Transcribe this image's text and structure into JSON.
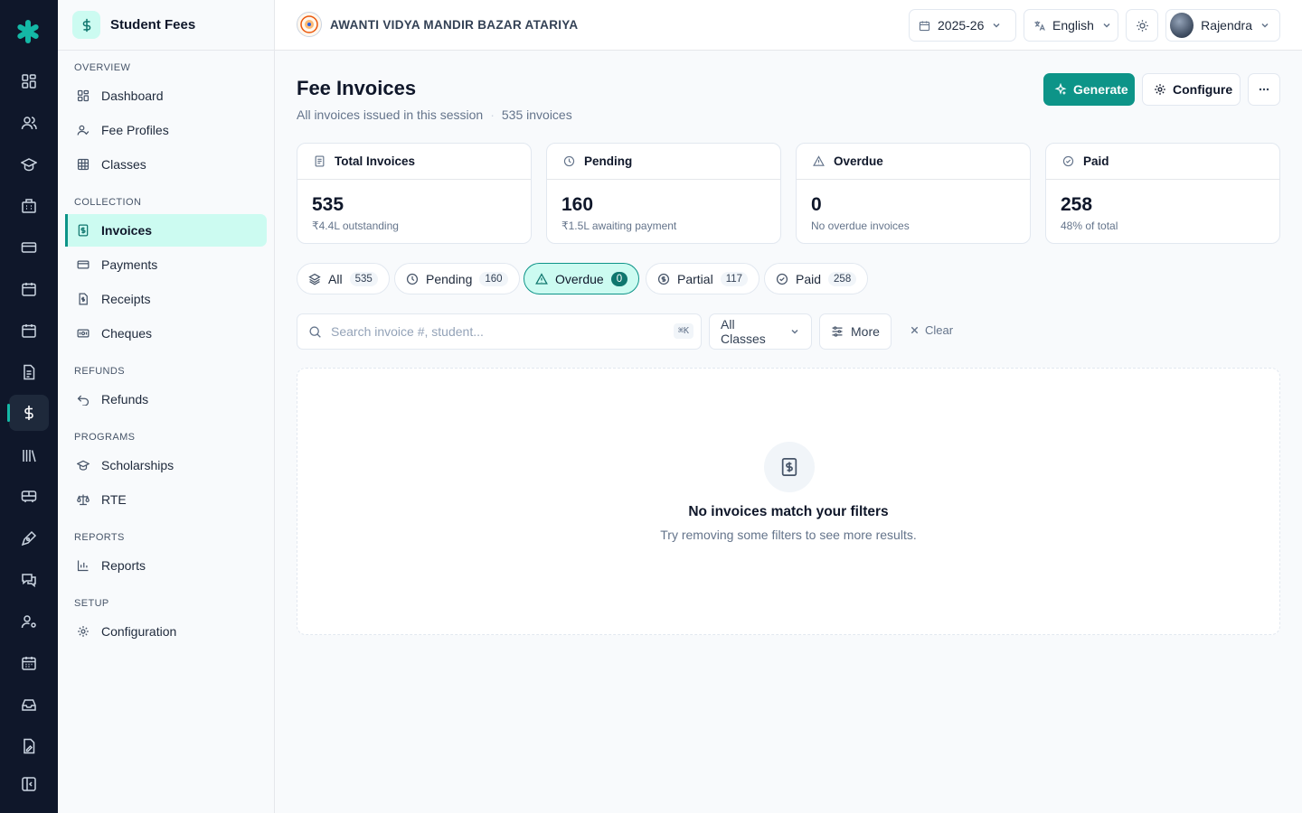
{
  "sidebar": {
    "title": "Student Fees",
    "sections": {
      "overview": "OVERVIEW",
      "collection": "COLLECTION",
      "refunds": "REFUNDS",
      "programs": "PROGRAMS",
      "reports": "REPORTS",
      "setup": "SETUP"
    },
    "items": {
      "dashboard": "Dashboard",
      "fee_profiles": "Fee Profiles",
      "classes": "Classes",
      "invoices": "Invoices",
      "payments": "Payments",
      "receipts": "Receipts",
      "cheques": "Cheques",
      "refunds": "Refunds",
      "scholarships": "Scholarships",
      "rte": "RTE",
      "reports": "Reports",
      "configuration": "Configuration"
    },
    "active_item": "Invoices"
  },
  "topbar": {
    "school_name": "AWANTI VIDYA MANDIR BAZAR ATARIYA",
    "session": "2025-26",
    "language": "English",
    "user": "Rajendra"
  },
  "page": {
    "title": "Fee Invoices",
    "subtitle": "All invoices issued in this session",
    "invoice_count": "535 invoices",
    "actions": {
      "generate": "Generate",
      "configure": "Configure"
    }
  },
  "stats": [
    {
      "label": "Total Invoices",
      "value": "535",
      "note": "₹4.4L outstanding",
      "icon": "receipt-icon"
    },
    {
      "label": "Pending",
      "value": "160",
      "note": "₹1.5L awaiting payment",
      "icon": "clock-icon"
    },
    {
      "label": "Overdue",
      "value": "0",
      "note": "No overdue invoices",
      "icon": "warning-icon"
    },
    {
      "label": "Paid",
      "value": "258",
      "note": "48% of total",
      "icon": "check-circle-icon"
    }
  ],
  "filters": {
    "tabs": [
      {
        "label": "All",
        "count": "535"
      },
      {
        "label": "Pending",
        "count": "160"
      },
      {
        "label": "Overdue",
        "count": "0"
      },
      {
        "label": "Partial",
        "count": "117"
      },
      {
        "label": "Paid",
        "count": "258"
      }
    ],
    "active_tab": "Overdue",
    "search_placeholder": "Search invoice #, student...",
    "search_shortcut": "⌘K",
    "class_select": "All Classes",
    "more": "More",
    "clear": "Clear"
  },
  "empty_state": {
    "title": "No invoices match your filters",
    "subtitle": "Try removing some filters to see more results."
  },
  "colors": {
    "accent": "#0d9488",
    "accent_light": "#ccfbf1",
    "rail": "#0f172a"
  }
}
